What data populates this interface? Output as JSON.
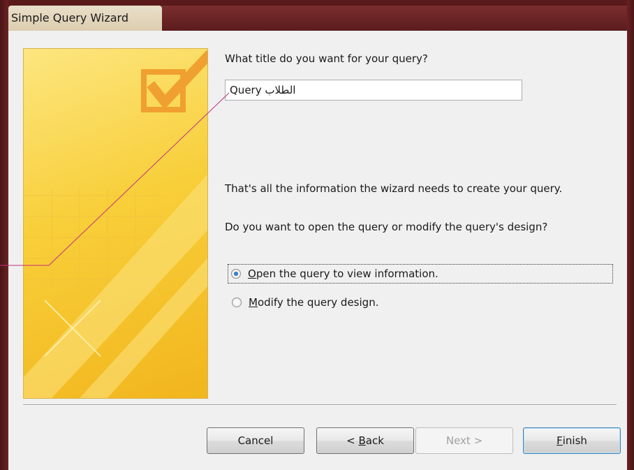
{
  "window": {
    "title": "Simple Query Wizard"
  },
  "wizard": {
    "prompt": "What title do you want for your query?",
    "query_title_value": "الطلاب Query",
    "info": "That's all the information the wizard needs to create your query.",
    "question": "Do you want to open the query or modify the query's design?",
    "options": [
      {
        "label_mnemonic": "O",
        "label_rest": "pen the query to view information.",
        "selected": true
      },
      {
        "label_mnemonic": "M",
        "label_rest": "odify the query design.",
        "selected": false
      }
    ]
  },
  "buttons": {
    "cancel": "Cancel",
    "back_prefix": "< ",
    "back_mnemonic": "B",
    "back_rest": "ack",
    "next": "Next >",
    "finish_mnemonic": "F",
    "finish_rest": "inish"
  },
  "colors": {
    "frame": "#5a1a1c",
    "dialog_bg": "#f0f0f0",
    "banner_yellow": "#f8cf3a",
    "checkmark_orange": "#f0a030",
    "annotation_line": "#c0307a"
  },
  "icons": {
    "banner_checkmark": "checkmark-icon",
    "radio": "radio-icon"
  }
}
